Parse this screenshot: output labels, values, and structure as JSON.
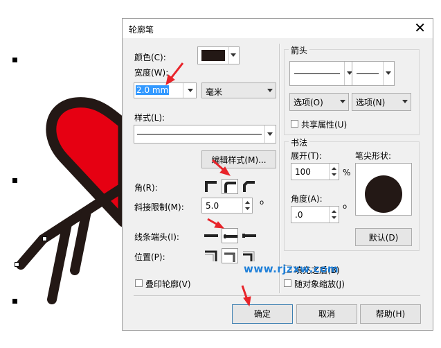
{
  "dialog": {
    "title": "轮廓笔",
    "close_symbol": "✕",
    "color_label": "颜色(C):",
    "color_value": "#231815",
    "width_label": "宽度(W):",
    "width_value": "2.0 mm",
    "unit_value": "毫米",
    "style_label": "样式(L):",
    "edit_style_button": "编辑样式(M)...",
    "corner_label": "角(R):",
    "miter_label": "斜接限制(M):",
    "miter_value": "5.0",
    "miter_unit": "o",
    "linecap_label": "线条端头(I):",
    "position_label": "位置(P):",
    "overprint_label": "叠印轮廓(V)",
    "ok_button": "确定",
    "cancel_button": "取消",
    "help_button": "帮助(H)"
  },
  "arrows": {
    "group_title": "箭头",
    "options_left": "选项(O)",
    "options_right": "选项(N)",
    "share_attr_label": "共享属性(U)"
  },
  "calligraphy": {
    "group_title": "书法",
    "stretch_label": "展开(T):",
    "stretch_value": "100",
    "stretch_unit": "%",
    "angle_label": "角度(A):",
    "angle_value": ".0",
    "angle_unit": "o",
    "nib_shape_label": "笔尖形状:",
    "default_button": "默认(D)",
    "behind_fill_label": "填充之后(B)",
    "scale_with_image_label": "随对象缩放(J)"
  },
  "watermark": "www.rjzxw.com",
  "colors": {
    "heart_red": "#e60012",
    "outline_dark": "#231815",
    "annotation_red": "#e8242a",
    "selection_blue": "#3399ff",
    "watermark_blue": "#1e7fd8"
  }
}
